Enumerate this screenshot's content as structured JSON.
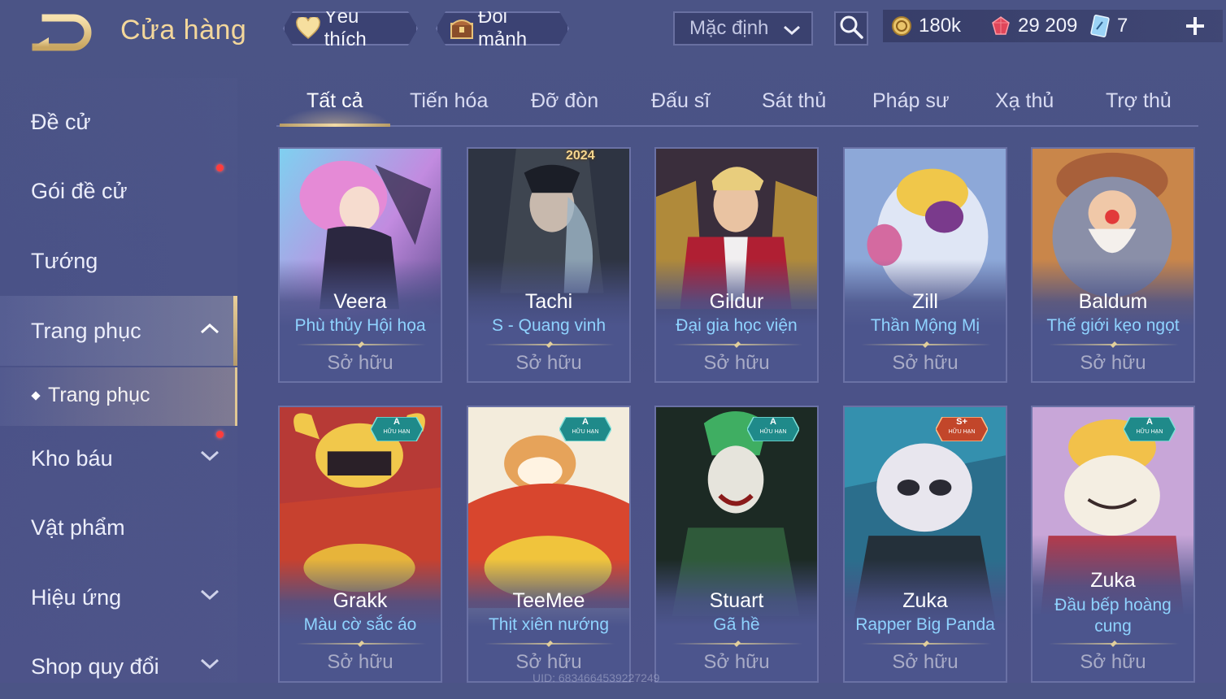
{
  "header": {
    "title": "Cửa hàng",
    "favorite_label": "Yêu thích",
    "exchange_label": "Đổi mảnh",
    "sort_value": "Mặc định",
    "currencies": {
      "gold": "180k",
      "gems": "29 209",
      "vouchers": "7"
    }
  },
  "sidebar": {
    "items": [
      {
        "label": "Đề cử"
      },
      {
        "label": "Gói đề cử"
      },
      {
        "label": "Tướng"
      },
      {
        "label": "Trang phục"
      },
      {
        "label": "Kho báu"
      },
      {
        "label": "Vật phẩm"
      },
      {
        "label": "Hiệu ứng"
      },
      {
        "label": "Shop quy đổi"
      }
    ],
    "sub_item": "Trang phục"
  },
  "tabs": [
    "Tất cả",
    "Tiến hóa",
    "Đỡ đòn",
    "Đấu sĩ",
    "Sát thủ",
    "Pháp sư",
    "Xạ thủ",
    "Trợ thủ"
  ],
  "cards": [
    {
      "hero": "Veera",
      "skin": "Phù thủy Hội họa",
      "status": "Sở hữu"
    },
    {
      "hero": "Tachi",
      "skin": "S - Quang vinh",
      "status": "Sở hữu",
      "year": "2024"
    },
    {
      "hero": "Gildur",
      "skin": "Đại gia học viện",
      "status": "Sở hữu"
    },
    {
      "hero": "Zill",
      "skin": "Thần Mộng Mị",
      "status": "Sở hữu"
    },
    {
      "hero": "Baldum",
      "skin": "Thế giới kẹo ngọt",
      "status": "Sở hữu"
    },
    {
      "hero": "Grakk",
      "skin": "Màu cờ sắc áo",
      "status": "Sở hữu",
      "tier": "A",
      "limited": "HỮU HẠN"
    },
    {
      "hero": "TeeMee",
      "skin": "Thịt xiên nướng",
      "status": "Sở hữu",
      "tier": "A",
      "limited": "HỮU HẠN"
    },
    {
      "hero": "Stuart",
      "skin": "Gã hề",
      "status": "Sở hữu",
      "tier": "A",
      "limited": "HỮU HẠN"
    },
    {
      "hero": "Zuka",
      "skin": "Rapper Big Panda",
      "status": "Sở hữu",
      "tier": "S+",
      "limited": "HỮU HẠN"
    },
    {
      "hero": "Zuka",
      "skin": "Đầu bếp hoàng cung",
      "status": "Sở hữu",
      "tier": "A",
      "limited": "HỮU HẠN"
    }
  ],
  "footer": {
    "uid": "UID: 6834664539227249"
  },
  "colors": {
    "accent_gold": "#f3d79b",
    "skin_blue": "#8fd3ff",
    "bg": "#4b5486"
  }
}
